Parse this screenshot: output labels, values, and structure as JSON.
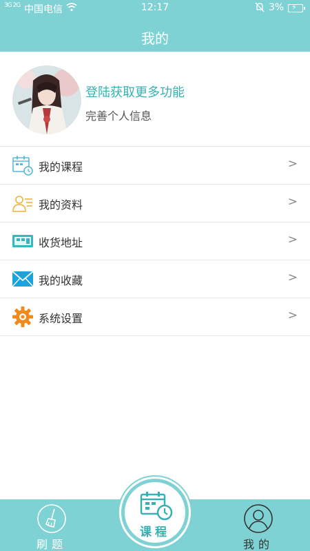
{
  "status_bar": {
    "signal_text": "3G 2G",
    "carrier": "中国电信",
    "time": "12:17",
    "battery": "3%"
  },
  "header": {
    "title": "我的"
  },
  "profile": {
    "login_prompt": "登陆获取更多功能",
    "complete_info": "完善个人信息"
  },
  "menu": {
    "items": [
      {
        "label": "我的课程",
        "icon": "calendar-clock-icon"
      },
      {
        "label": "我的资料",
        "icon": "profile-card-icon"
      },
      {
        "label": "收货地址",
        "icon": "address-icon"
      },
      {
        "label": "我的收藏",
        "icon": "envelope-icon"
      },
      {
        "label": "系统设置",
        "icon": "gear-icon"
      }
    ],
    "chevron": ">"
  },
  "tabs": {
    "left": {
      "label": "刷题",
      "icon": "brush-icon"
    },
    "center": {
      "label": "课程",
      "icon": "calendar-clock-icon"
    },
    "right": {
      "label": "我的",
      "icon": "user-icon"
    }
  },
  "colors": {
    "accent": "#7ed2d3",
    "accent_text": "#38b0b2",
    "divider": "#e6e6e6"
  }
}
